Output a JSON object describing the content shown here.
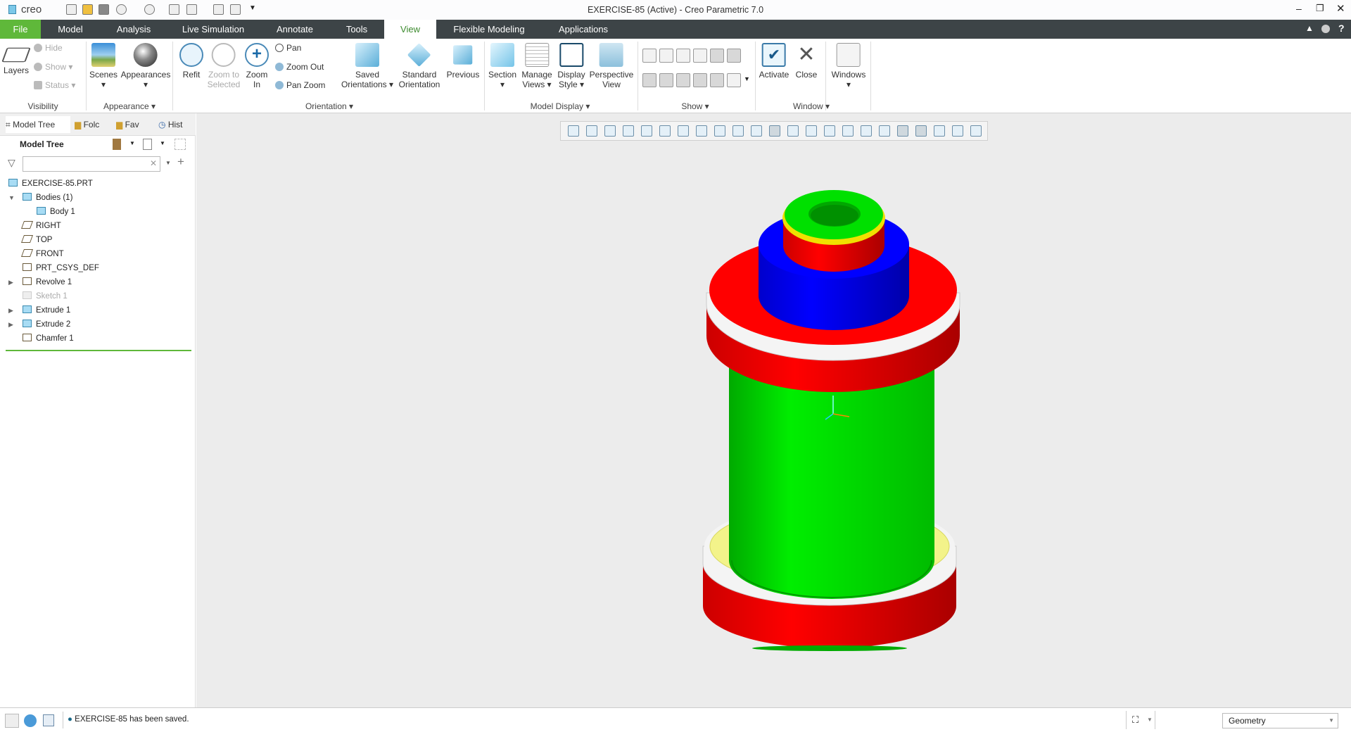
{
  "app": {
    "logo": "creo",
    "title": "EXERCISE-85 (Active) - Creo Parametric 7.0"
  },
  "menu": {
    "tabs": [
      "File",
      "Model",
      "Analysis",
      "Live Simulation",
      "Annotate",
      "Tools",
      "View",
      "Flexible Modeling",
      "Applications"
    ],
    "active": "View"
  },
  "ribbon": {
    "visibility": {
      "layers": "Layers",
      "hide": "Hide",
      "show": "Show",
      "status": "Status",
      "label": "Visibility"
    },
    "appearance": {
      "scenes": "Scenes",
      "appearances": "Appearances",
      "label": "Appearance ▾"
    },
    "orientation": {
      "refit": "Refit",
      "zoom_selected_1": "Zoom to",
      "zoom_selected_2": "Selected",
      "zoom_in_1": "Zoom",
      "zoom_in_2": "In",
      "pan": "Pan",
      "zoom_out": "Zoom Out",
      "pan_zoom": "Pan Zoom",
      "saved_1": "Saved",
      "saved_2": "Orientations ▾",
      "standard_1": "Standard",
      "standard_2": "Orientation",
      "previous": "Previous",
      "label": "Orientation ▾"
    },
    "model_display": {
      "section": "Section",
      "manage_1": "Manage",
      "manage_2": "Views ▾",
      "display_1": "Display",
      "display_2": "Style ▾",
      "perspective_1": "Perspective",
      "perspective_2": "View",
      "label": "Model Display ▾"
    },
    "show": {
      "label": "Show ▾"
    },
    "window": {
      "activate": "Activate",
      "close": "Close",
      "windows": "Windows",
      "label": "Window ▾"
    }
  },
  "sidebar": {
    "tabs": [
      "Model Tree",
      "Folder Browser",
      "Favorites",
      "History"
    ],
    "tab_short": [
      "Model Tree",
      "Folc",
      "Fav",
      "Hist"
    ],
    "header": "Model Tree",
    "search": {
      "value": "",
      "placeholder": ""
    },
    "tree": [
      {
        "label": "EXERCISE-85.PRT",
        "level": 0,
        "expandable": false
      },
      {
        "label": "Bodies (1)",
        "level": 1,
        "expanded": true
      },
      {
        "label": "Body 1",
        "level": 2
      },
      {
        "label": "RIGHT",
        "level": 1
      },
      {
        "label": "TOP",
        "level": 1
      },
      {
        "label": "FRONT",
        "level": 1
      },
      {
        "label": "PRT_CSYS_DEF",
        "level": 1
      },
      {
        "label": "Revolve 1",
        "level": 1,
        "expandable": true
      },
      {
        "label": "Sketch 1",
        "level": 1,
        "suppressed": true
      },
      {
        "label": "Extrude 1",
        "level": 1,
        "expandable": true
      },
      {
        "label": "Extrude 2",
        "level": 1,
        "expandable": true
      },
      {
        "label": "Chamfer 1",
        "level": 1
      }
    ]
  },
  "status": {
    "message": "EXERCISE-85 has been saved.",
    "filter": "Geometry"
  },
  "colors": {
    "menubar": "#3d4447",
    "file_tab": "#5fb83a",
    "model_red": "#ee0000",
    "model_green": "#00dd00",
    "model_blue": "#0000ee",
    "model_yellow": "#f3f38a"
  }
}
